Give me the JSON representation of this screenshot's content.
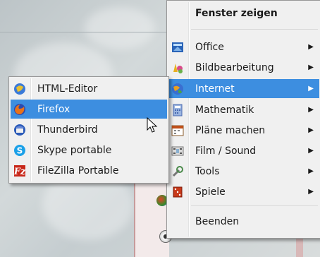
{
  "main_menu": {
    "title": "Fenster zeigen",
    "items": [
      {
        "label": "Office",
        "icon": "office-icon",
        "arrow": "▶"
      },
      {
        "label": "Bildbearbeitung",
        "icon": "image-edit-icon",
        "arrow": "▶"
      },
      {
        "label": "Internet",
        "icon": "internet-icon",
        "arrow": "▶"
      },
      {
        "label": "Mathematik",
        "icon": "math-icon",
        "arrow": "▶"
      },
      {
        "label": "Pläne machen",
        "icon": "calendar-icon",
        "arrow": "▶"
      },
      {
        "label": "Film / Sound",
        "icon": "film-icon",
        "arrow": "▶"
      },
      {
        "label": "Tools",
        "icon": "tools-icon",
        "arrow": "▶"
      },
      {
        "label": "Spiele",
        "icon": "games-icon",
        "arrow": "▶"
      }
    ],
    "exit_label": "Beenden"
  },
  "submenu": {
    "items": [
      {
        "label": "HTML-Editor",
        "icon": "html-editor-icon"
      },
      {
        "label": "Firefox",
        "icon": "firefox-icon"
      },
      {
        "label": "Thunderbird",
        "icon": "thunderbird-icon"
      },
      {
        "label": "Skype portable",
        "icon": "skype-icon"
      },
      {
        "label": "FileZilla Portable",
        "icon": "filezilla-icon"
      }
    ]
  },
  "colors": {
    "highlight": "#3d8ee0",
    "menu_bg": "#f0f0f0"
  }
}
